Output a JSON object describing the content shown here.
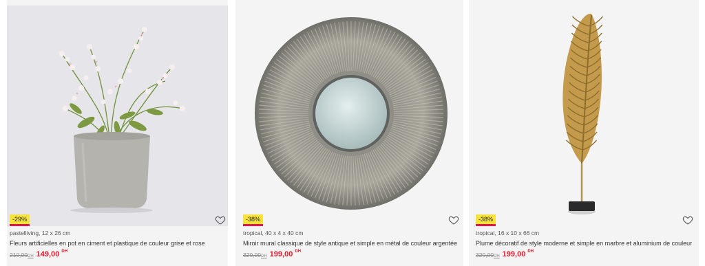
{
  "products": [
    {
      "discount": "-29%",
      "meta": "pastelliving, 12 x 26 cm",
      "title": "Fleurs artificielles en pot en ciment et plastique de couleur grise et rose",
      "old_price": "210,00",
      "new_price": "149,00",
      "currency": "DH",
      "image_icon": "potted-flowers",
      "favorite_icon": "heart-outline-icon"
    },
    {
      "discount": "-38%",
      "meta": "tropical, 40 x 4 x 40 cm",
      "title": "Miroir mural classique de style antique et simple en métal de couleur argentée",
      "old_price": "320,00",
      "new_price": "199,00",
      "currency": "DH",
      "image_icon": "round-wall-mirror",
      "favorite_icon": "heart-outline-icon"
    },
    {
      "discount": "-38%",
      "meta": "tropical, 16 x 10 x 66 cm",
      "title": "Plume décoratif de style moderne et simple en marbre et aluminium de couleur",
      "old_price": "320,00",
      "new_price": "199,00",
      "currency": "DH",
      "image_icon": "golden-leaf-sculpture",
      "favorite_icon": "heart-outline-icon"
    }
  ],
  "colors": {
    "price_red": "#e51a2a",
    "badge_yellow": "#f6e23a",
    "badge_underline": "#e0154a",
    "card_bg": "#f4f4f4"
  }
}
